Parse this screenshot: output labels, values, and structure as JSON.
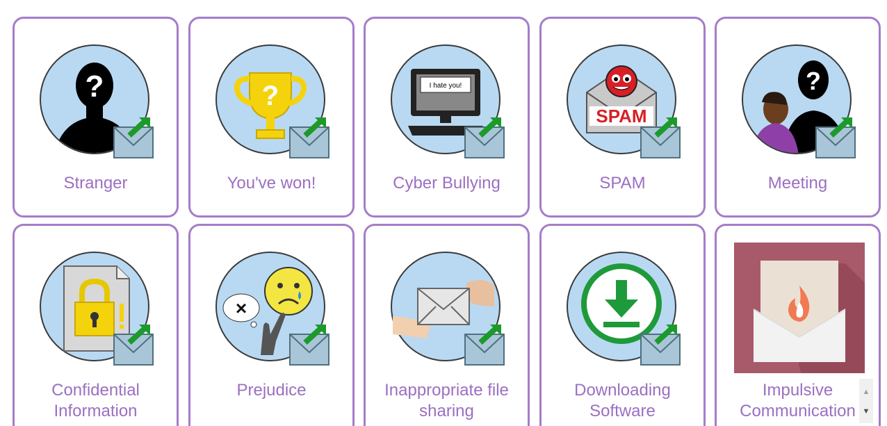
{
  "tiles": [
    {
      "label": "Stranger",
      "icon": "stranger-icon"
    },
    {
      "label": "You've won!",
      "icon": "trophy-icon"
    },
    {
      "label": "Cyber Bullying",
      "icon": "computer-bullying-icon",
      "screen_text": "I hate you!"
    },
    {
      "label": "SPAM",
      "icon": "spam-icon",
      "badge_text": "SPAM"
    },
    {
      "label": "Meeting",
      "icon": "meeting-icon"
    },
    {
      "label": "Confidential Information",
      "icon": "padlock-document-icon"
    },
    {
      "label": "Prejudice",
      "icon": "sad-face-icon"
    },
    {
      "label": "Inappropriate file sharing",
      "icon": "envelope-hands-icon"
    },
    {
      "label": "Downloading Software",
      "icon": "download-icon"
    },
    {
      "label": "Impulsive Communication",
      "icon": "fire-envelope-icon"
    }
  ],
  "colors": {
    "border": "#a57cc9",
    "label": "#9b6fc2",
    "circle_fill": "#b9d9f2",
    "tile_bg": "#a85a6a"
  },
  "scrollbar": {
    "up_icon": "scroll-up-arrow-icon",
    "down_icon": "scroll-down-arrow-icon"
  }
}
